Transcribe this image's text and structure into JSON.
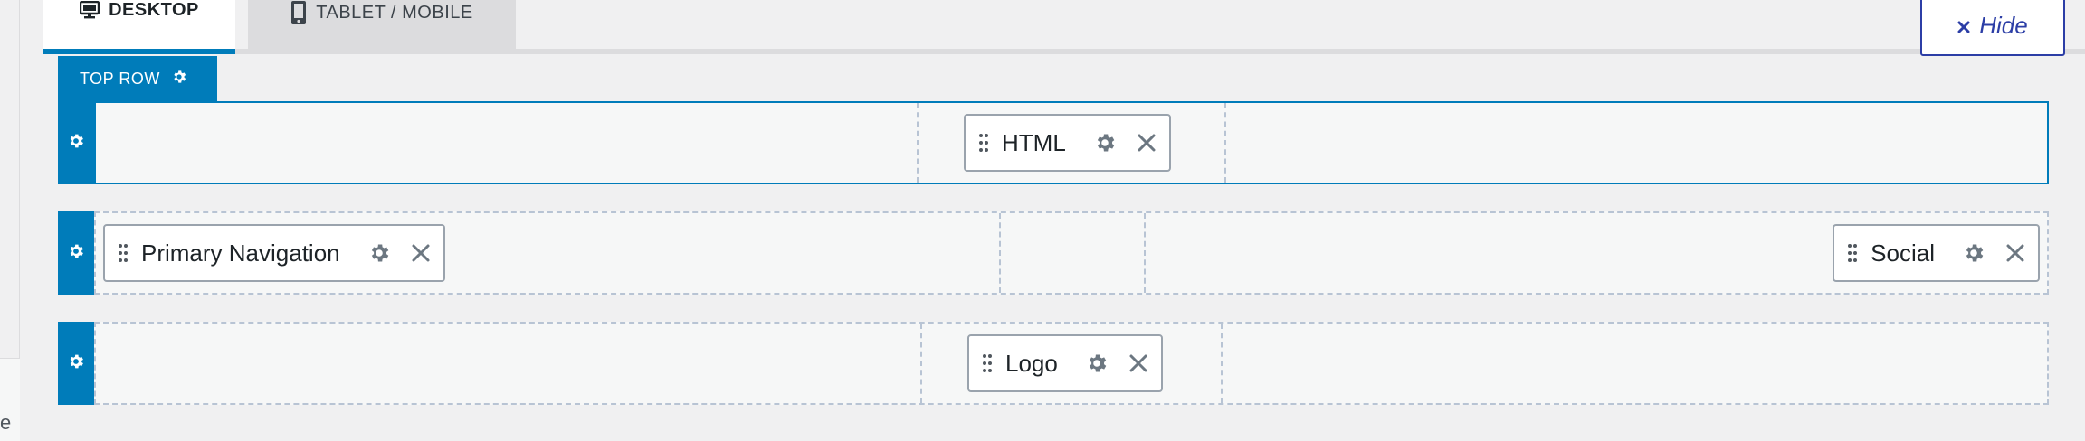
{
  "tabs": [
    {
      "label": "DESKTOP",
      "icon": "desktop-icon"
    },
    {
      "label": "TABLET / MOBILE",
      "icon": "tablet-icon"
    }
  ],
  "hide_button": {
    "label": "Hide",
    "icon": "close-icon"
  },
  "top_row_label": "TOP ROW",
  "rows": {
    "top": {
      "items": [
        {
          "label": "HTML"
        }
      ]
    },
    "main": {
      "items": [
        {
          "label": "Primary Navigation"
        },
        {
          "label": "Social"
        }
      ]
    },
    "bottom": {
      "items": [
        {
          "label": "Logo"
        }
      ]
    }
  },
  "admin_edge_glyph": "e",
  "colors": {
    "accent": "#007cba",
    "hide_accent": "#2c3ea6",
    "icon_gray": "#6c7781"
  }
}
